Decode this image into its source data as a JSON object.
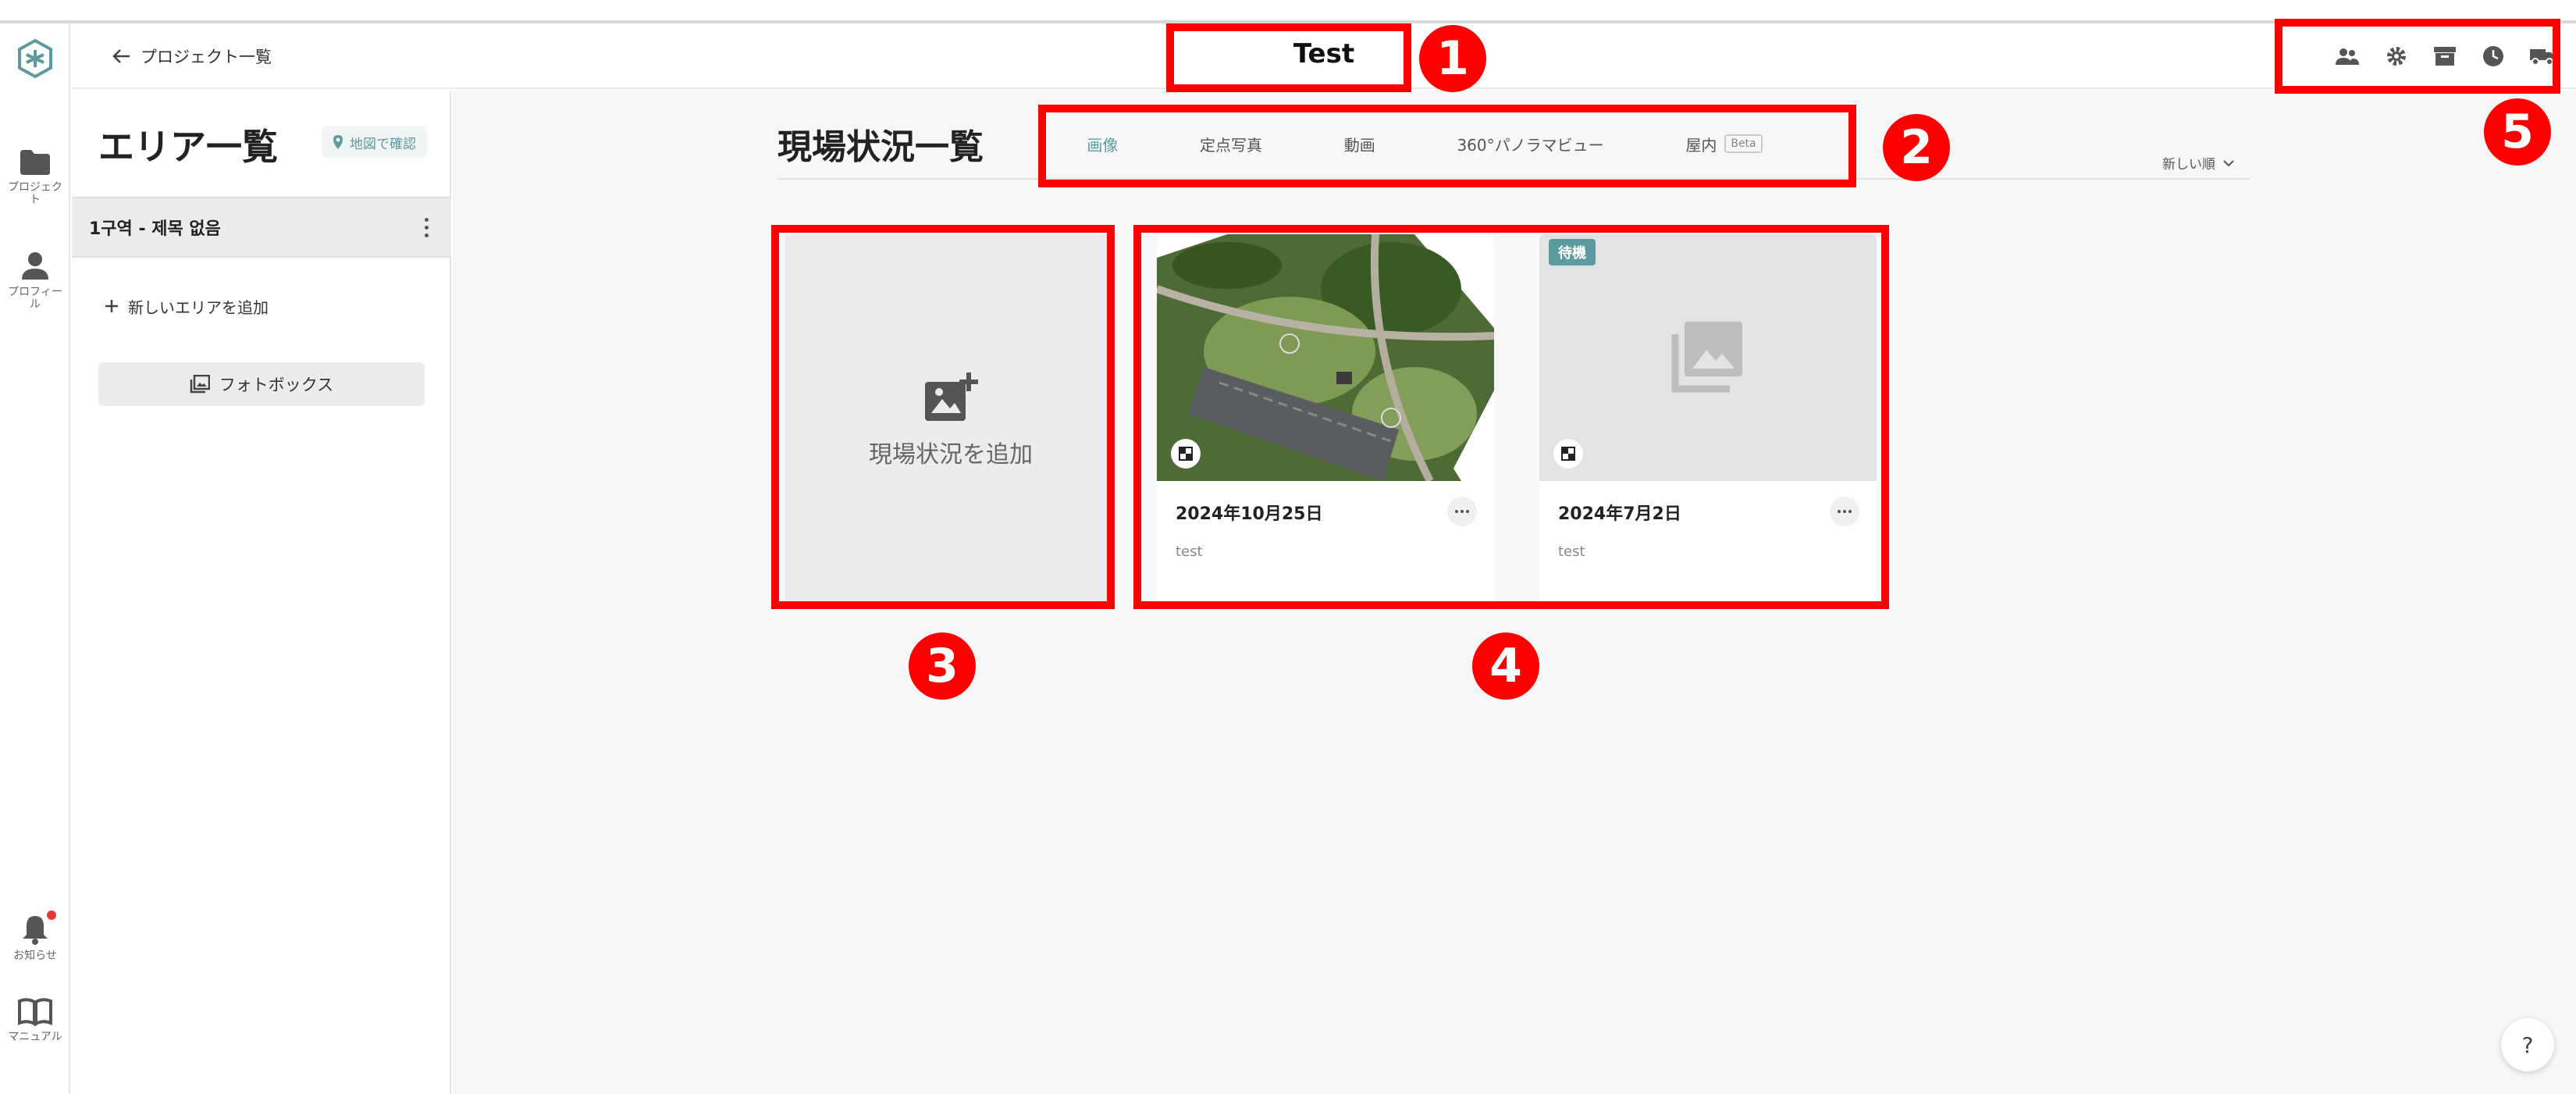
{
  "header": {
    "back_label": "プロジェクト一覧",
    "project_title": "Test",
    "icons": [
      "team-icon",
      "gear-icon",
      "archive-icon",
      "clock-icon",
      "truck-icon"
    ]
  },
  "rail": {
    "items": [
      {
        "icon": "folder-icon",
        "label": "プロジェクト"
      },
      {
        "icon": "person-icon",
        "label": "プロフィール"
      },
      {
        "icon": "bell-icon",
        "label": "お知らせ"
      },
      {
        "icon": "book-icon",
        "label": "マニュアル"
      }
    ]
  },
  "area_panel": {
    "title": "エリア一覧",
    "map_button": "地図で確認",
    "areas": [
      {
        "label": "1구역 - 제목 없음"
      }
    ],
    "add_area": "新しいエリアを追加",
    "photobox": "フォトボックス"
  },
  "main": {
    "title": "現場状況一覧",
    "tabs": [
      {
        "label": "画像",
        "active": true
      },
      {
        "label": "定点写真",
        "active": false
      },
      {
        "label": "動画",
        "active": false
      },
      {
        "label": "360°パノラマビュー",
        "active": false
      },
      {
        "label": "屋内",
        "active": false,
        "badge": "Beta"
      }
    ],
    "sort_label": "新しい順",
    "add_card_label": "現場状況を追加",
    "cards": [
      {
        "date": "2024年10月25日",
        "description": "test",
        "status": ""
      },
      {
        "date": "2024年7月2日",
        "description": "test",
        "status": "待機"
      }
    ]
  },
  "help_label": "?",
  "annotations": [
    "1",
    "2",
    "3",
    "4",
    "5"
  ],
  "colors": {
    "accent": "#5d9aa0",
    "annotation": "#ff0000",
    "notification": "#e53935"
  }
}
